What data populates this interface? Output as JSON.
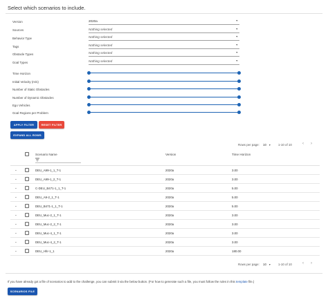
{
  "title": "Select which scenarios to include.",
  "form": {
    "version_label": "Version",
    "version_value": "2020a",
    "selects": [
      {
        "label": "Sources",
        "value": "Nothing selected"
      },
      {
        "label": "Behavior Type",
        "value": "Nothing selected"
      },
      {
        "label": "Tags",
        "value": "Nothing selected"
      },
      {
        "label": "Obstacle Types",
        "value": "Nothing selected"
      },
      {
        "label": "Goal Types",
        "value": "Nothing selected"
      }
    ],
    "sliders": [
      {
        "label": "Time Horizon"
      },
      {
        "label": "Initial Velocity (m/s)"
      },
      {
        "label": "Number of Static Obstacles"
      },
      {
        "label": "Number of Dynamic Obstacles"
      },
      {
        "label": "Ego Vehicles"
      },
      {
        "label": "Goal Regions per Problem"
      }
    ]
  },
  "buttons": {
    "apply": "APPLY FILTER",
    "reset": "RESET FILTER",
    "expand": "EXPAND ALL ROWS",
    "scenarios_file": "SCENARIOS FILE"
  },
  "pagination": {
    "rows_per_page_label": "Rows per page:",
    "rows_per_page_value": "10",
    "range": "1-10 of 10"
  },
  "table": {
    "headers": {
      "name": "Scenario Name",
      "version": "Version",
      "horizon": "Time Horizon"
    },
    "rows": [
      {
        "name": "DEU_A99-1_1_T-1",
        "version": "2020a",
        "horizon": "3.00"
      },
      {
        "name": "DEU_A99-1_2_T-1",
        "version": "2020a",
        "horizon": "3.00"
      },
      {
        "name": "C-DEU_B471-1_1_T-1",
        "version": "2020a",
        "horizon": "5.00"
      },
      {
        "name": "DEU_A9-2_1_T-1",
        "version": "2020a",
        "horizon": "5.00"
      },
      {
        "name": "DEU_B471-1_1_T-1",
        "version": "2020a",
        "horizon": "5.00"
      },
      {
        "name": "DEU_Muc-2_1_T-1",
        "version": "2020a",
        "horizon": "3.00"
      },
      {
        "name": "DEU_Muc-2_2_T-1",
        "version": "2020a",
        "horizon": "3.00"
      },
      {
        "name": "DEU_Muc-4_1_T-1",
        "version": "2020a",
        "horizon": "3.00"
      },
      {
        "name": "DEU_Muc-4_2_T-1",
        "version": "2020a",
        "horizon": "3.00"
      },
      {
        "name": "DEU_Hhr-1_1",
        "version": "2020a",
        "horizon": "180.00"
      }
    ]
  },
  "footer": {
    "text_before": "If you have already got a file of scenarios to add to the challenge, you can submit it via the below button. (For how to generate such a file, you must follow the rules in this ",
    "link": "template",
    "text_after": " file.)"
  },
  "icons": {
    "dropdown": "caret-down-icon",
    "expand": "chevron-down-icon",
    "filter": "filter-icon",
    "prev": "chevron-left-icon",
    "next": "chevron-right-icon"
  },
  "colors": {
    "primary": "#1a56b0",
    "danger": "#e8483b",
    "slider": "#1e64b4"
  }
}
